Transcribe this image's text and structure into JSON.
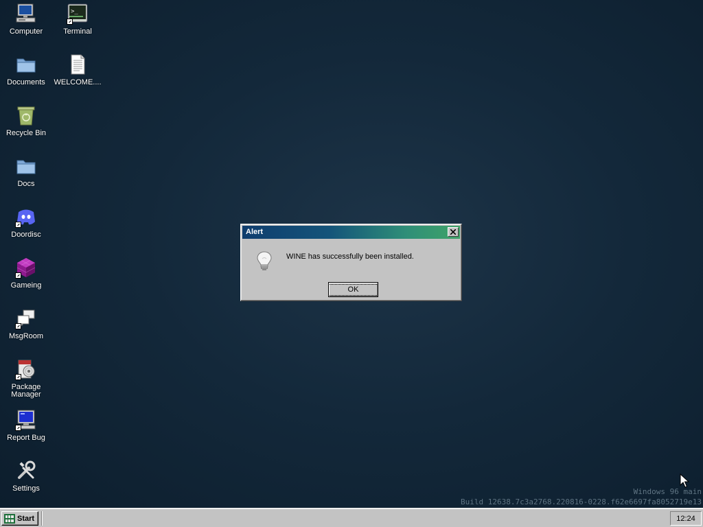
{
  "desktop": {
    "icons": [
      {
        "id": "computer",
        "label": "Computer",
        "icon": "computer-icon",
        "shortcut": false
      },
      {
        "id": "terminal",
        "label": "Terminal",
        "icon": "terminal-icon",
        "shortcut": true
      },
      {
        "id": "documents",
        "label": "Documents",
        "icon": "folder-icon",
        "shortcut": false
      },
      {
        "id": "welcome",
        "label": "WELCOME....",
        "icon": "text-document-icon",
        "shortcut": false
      },
      {
        "id": "recycle-bin",
        "label": "Recycle Bin",
        "icon": "recycle-bin-icon",
        "shortcut": false
      },
      {
        "id": "docs",
        "label": "Docs",
        "icon": "folder-icon",
        "shortcut": false
      },
      {
        "id": "doordisc",
        "label": "Doordisc",
        "icon": "doordisc-icon",
        "shortcut": true
      },
      {
        "id": "gameing",
        "label": "Gameing",
        "icon": "cube-icon",
        "shortcut": true
      },
      {
        "id": "msgroom",
        "label": "MsgRoom",
        "icon": "msgroom-icon",
        "shortcut": true
      },
      {
        "id": "package-manager",
        "label": "Package Manager",
        "icon": "package-manager-icon",
        "shortcut": true
      },
      {
        "id": "report-bug",
        "label": "Report Bug",
        "icon": "report-bug-icon",
        "shortcut": true
      },
      {
        "id": "settings",
        "label": "Settings",
        "icon": "settings-icon",
        "shortcut": false
      }
    ]
  },
  "alert": {
    "title": "Alert",
    "message": "WINE has successfully been installed.",
    "ok_label": "OK",
    "icon": "lightbulb-icon",
    "close_icon": "close-icon"
  },
  "watermark": {
    "line1": "Windows 96 main",
    "line2": "Build 12638.7c3a2768.220816-0228.f62e6697fa8052719e13"
  },
  "taskbar": {
    "start_label": "Start",
    "start_icon": "start-logo-icon",
    "clock": "12:24"
  },
  "colors": {
    "desktop_bg": "#13283a",
    "titlebar_start": "#0f3d6e",
    "titlebar_end": "#3fa368",
    "face": "#c3c3c3",
    "watermark": "#5f7483"
  }
}
